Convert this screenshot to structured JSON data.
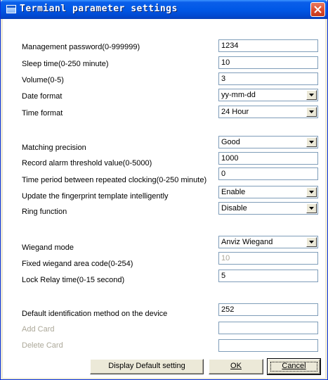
{
  "window": {
    "title": "Termianl parameter settings"
  },
  "settings": [
    {
      "label": "Management password(0-999999)",
      "type": "text",
      "value": "1234",
      "enabled": true
    },
    {
      "label": "Sleep time(0-250 minute)",
      "type": "text",
      "value": "10",
      "enabled": true
    },
    {
      "label": "Volume(0-5)",
      "type": "text",
      "value": "3",
      "enabled": true
    },
    {
      "label": "Date format",
      "type": "select",
      "value": "yy-mm-dd",
      "enabled": true
    },
    {
      "label": "Time format",
      "type": "select",
      "value": "24 Hour",
      "enabled": true
    },
    {
      "label": "Matching precision",
      "type": "select",
      "value": "Good",
      "enabled": true
    },
    {
      "label": "Record alarm threshold value(0-5000)",
      "type": "text",
      "value": "1000",
      "enabled": true
    },
    {
      "label": "Time period between repeated clocking(0-250 minute)",
      "type": "text",
      "value": "0",
      "enabled": true
    },
    {
      "label": "Update the fingerprint template intelligently",
      "type": "select",
      "value": "Enable",
      "enabled": true
    },
    {
      "label": "Ring function",
      "type": "select",
      "value": "Disable",
      "enabled": true
    },
    {
      "label": "Wiegand mode",
      "type": "select",
      "value": "Anviz Wiegand",
      "enabled": true
    },
    {
      "label": "Fixed wiegand area code(0-254)",
      "type": "text",
      "value": "10",
      "enabled": false
    },
    {
      "label": "Lock Relay time(0-15 second)",
      "type": "text",
      "value": "5",
      "enabled": true
    },
    {
      "label": "Default identification method on the device",
      "type": "text",
      "value": "252",
      "enabled": true
    },
    {
      "label": "Add Card",
      "type": "text",
      "value": "",
      "enabled": false
    },
    {
      "label": "Delete Card",
      "type": "text",
      "value": "",
      "enabled": false
    }
  ],
  "buttons": {
    "display_default": "Display Default setting",
    "ok": "OK",
    "cancel": "Cancel"
  },
  "colors": {
    "titlebar": "#0058e6",
    "close_button": "#d9482a",
    "field_border": "#7f9db9",
    "disabled_text": "#aca899"
  },
  "icons": {
    "app": "window-app-icon",
    "close": "close-icon",
    "dropdown": "chevron-down-icon"
  }
}
